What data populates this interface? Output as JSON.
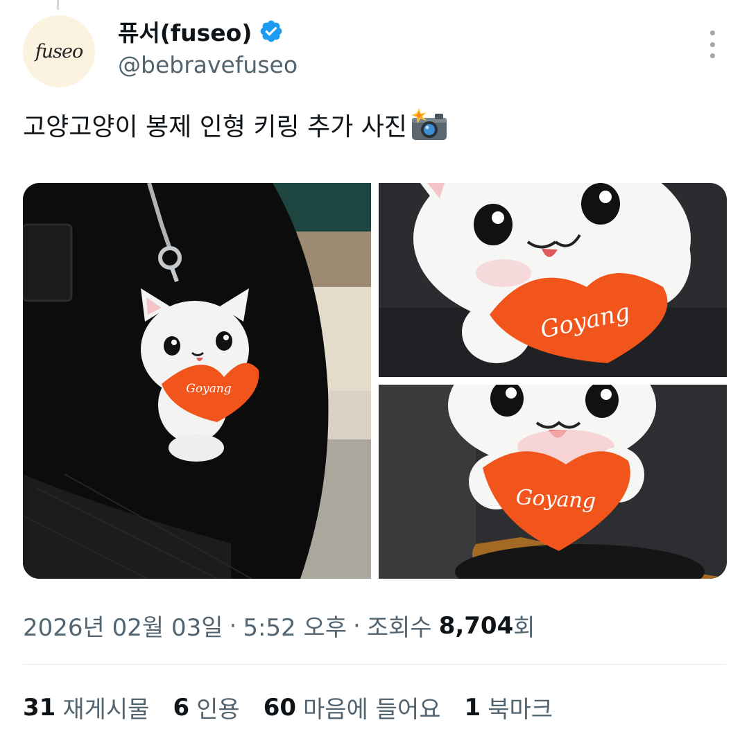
{
  "user": {
    "display_name": "퓨서(fuseo)",
    "handle": "@bebravefuseo",
    "avatar_logo": "fuseo",
    "verified": true,
    "verified_color": "#1d9bf0"
  },
  "tweet": {
    "text": "고양고양이 봉제 인형 키링 추가 사진",
    "emoji_icon": "camera-with-flash-icon",
    "media": [
      {
        "image_text": "Goyang"
      },
      {
        "image_text": "Goyang"
      },
      {
        "image_text": "Goyang"
      }
    ]
  },
  "meta": {
    "date": "2026년 02월 03일",
    "separator": "·",
    "time": "5:52 오후",
    "views_label": "조회수",
    "views_count": "8,704",
    "views_suffix": "회"
  },
  "stats": [
    {
      "count": "31",
      "label": "재게시물"
    },
    {
      "count": "6",
      "label": "인용"
    },
    {
      "count": "60",
      "label": "마음에 들어요"
    },
    {
      "count": "1",
      "label": "북마크"
    }
  ]
}
